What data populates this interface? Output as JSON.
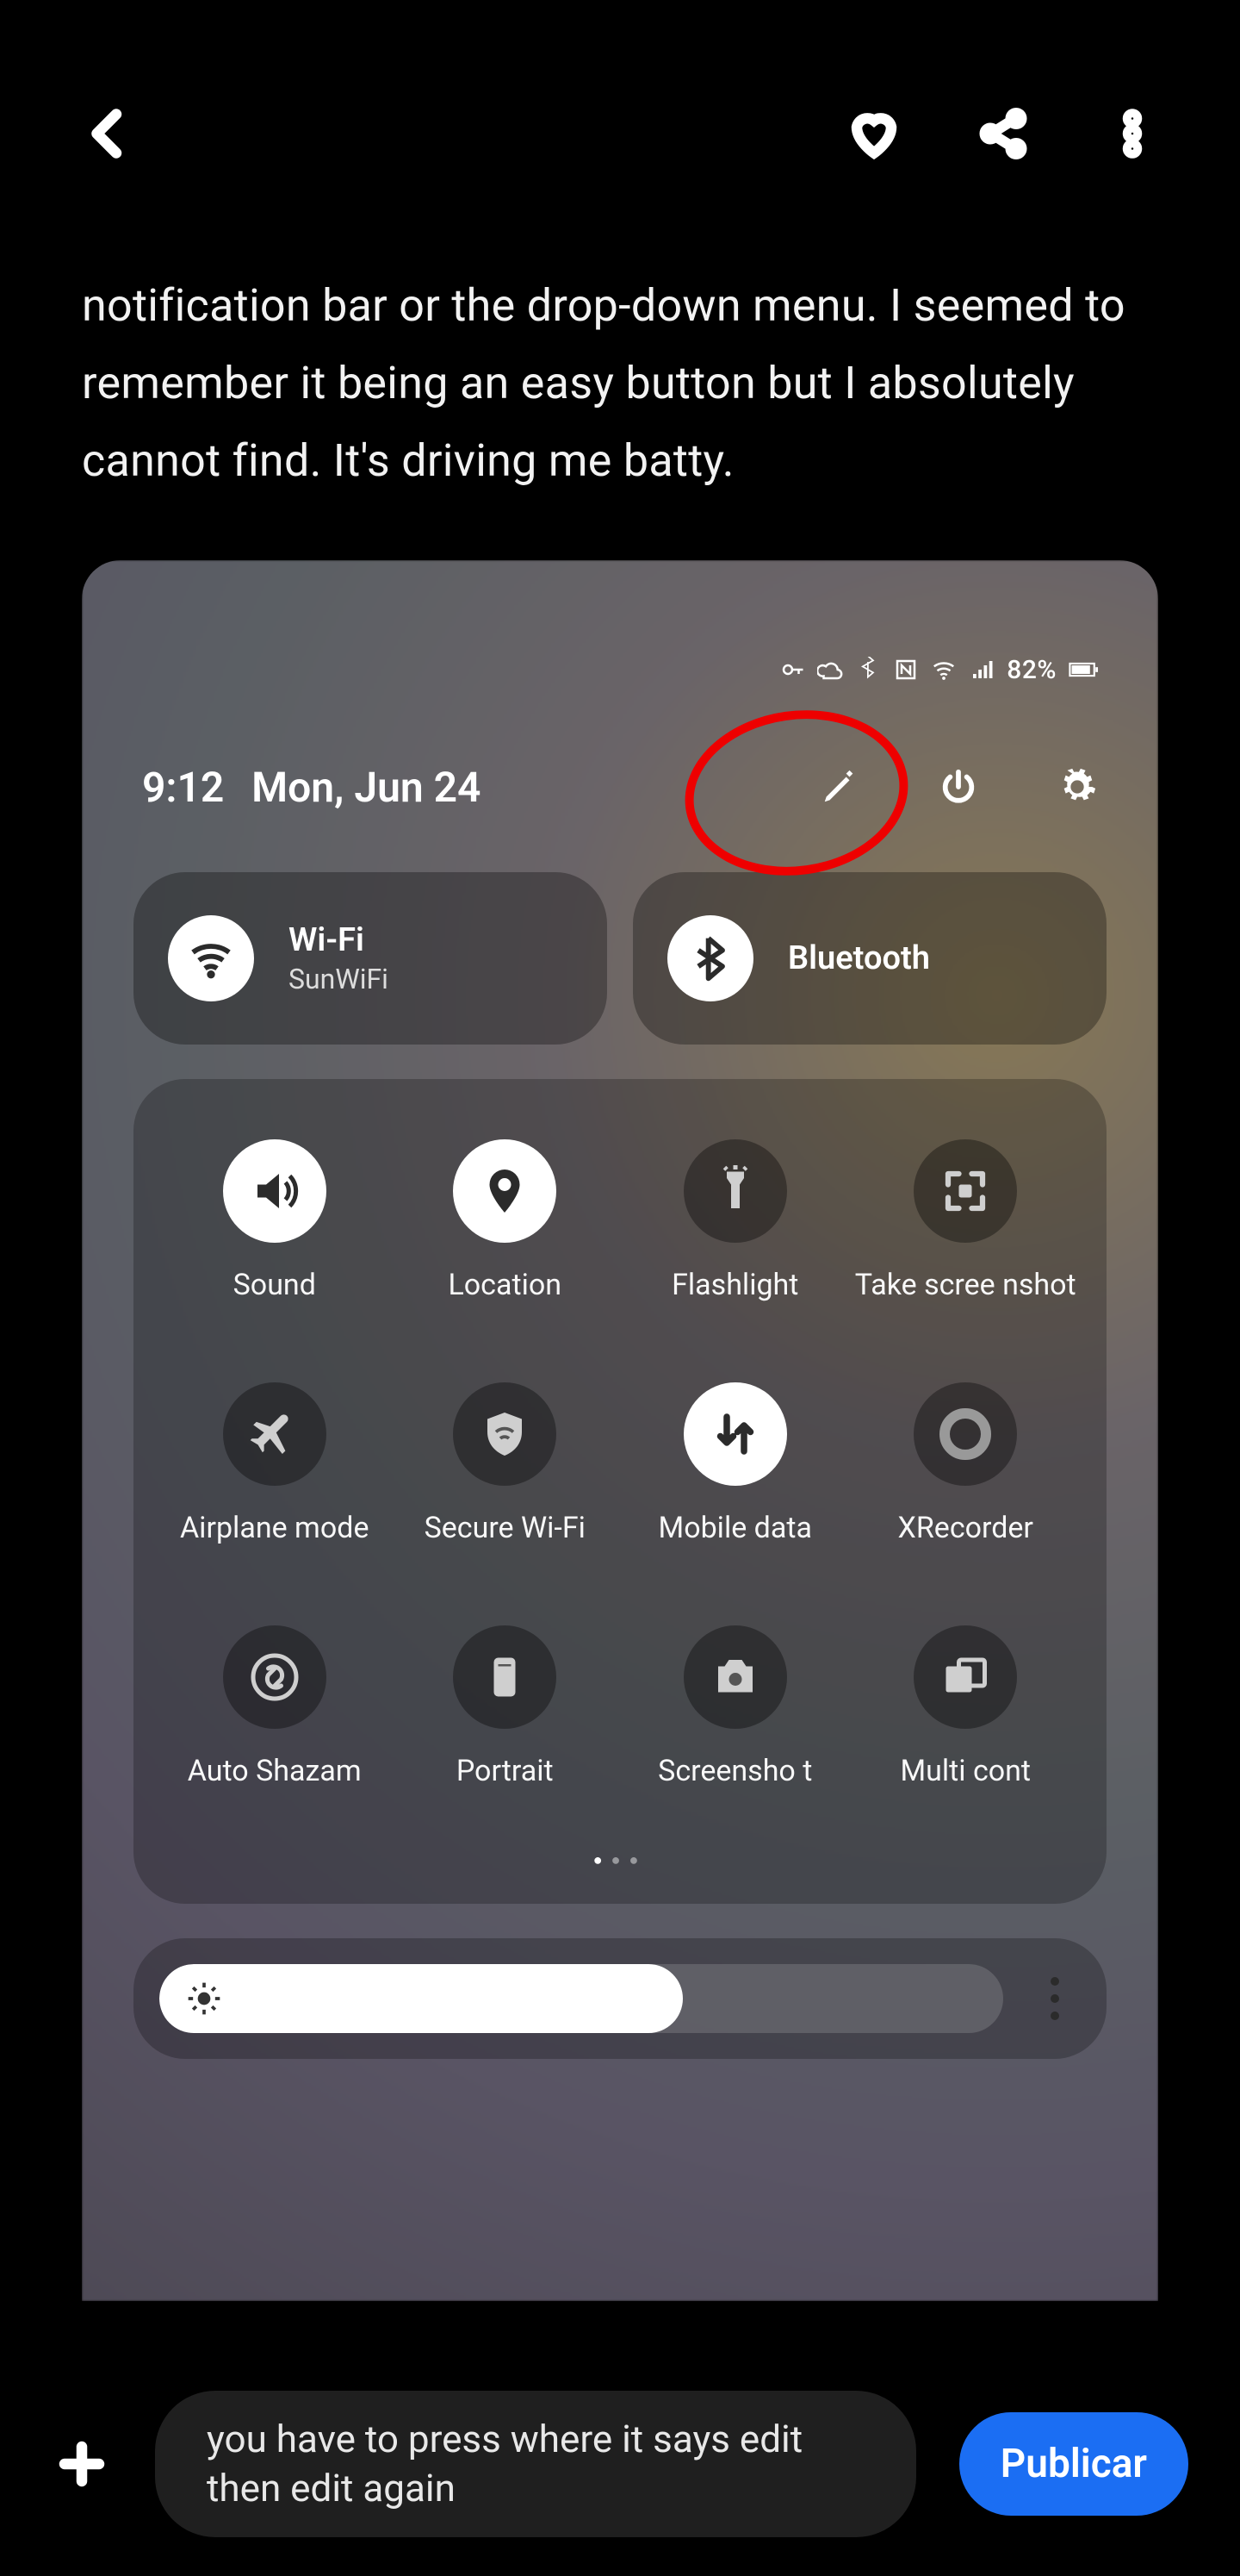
{
  "top_bar": {},
  "post": {
    "text": "notification bar or the drop-down menu. I seemed to remember it being an easy button but I absolutely cannot find. It's driving me batty."
  },
  "screenshot": {
    "status": {
      "battery": "82%"
    },
    "time": "9:12",
    "date": "Mon, Jun 24",
    "wifi": {
      "label": "Wi-Fi",
      "network": "SunWiFi"
    },
    "bluetooth": {
      "label": "Bluetooth"
    },
    "tiles": [
      {
        "label": "Sound",
        "on": true,
        "icon": "sound"
      },
      {
        "label": "Location",
        "on": true,
        "icon": "location"
      },
      {
        "label": "Flashlight",
        "on": false,
        "icon": "flashlight"
      },
      {
        "label": "Take scree nshot",
        "on": false,
        "icon": "screenshot"
      },
      {
        "label": "Airplane mode",
        "on": false,
        "icon": "airplane"
      },
      {
        "label": "Secure Wi-Fi",
        "on": false,
        "icon": "shield"
      },
      {
        "label": "Mobile data",
        "on": true,
        "icon": "data"
      },
      {
        "label": "XRecorder",
        "on": false,
        "icon": "recorder"
      },
      {
        "label": "Auto Shazam",
        "on": false,
        "icon": "shazam"
      },
      {
        "label": "Portrait",
        "on": false,
        "icon": "portrait"
      },
      {
        "label": "Screensho t",
        "on": false,
        "icon": "camera"
      },
      {
        "label": "Multi cont",
        "on": false,
        "icon": "multi"
      }
    ]
  },
  "comment": {
    "draft": "you have to press where it says edit then edit again",
    "publish_label": "Publicar"
  }
}
